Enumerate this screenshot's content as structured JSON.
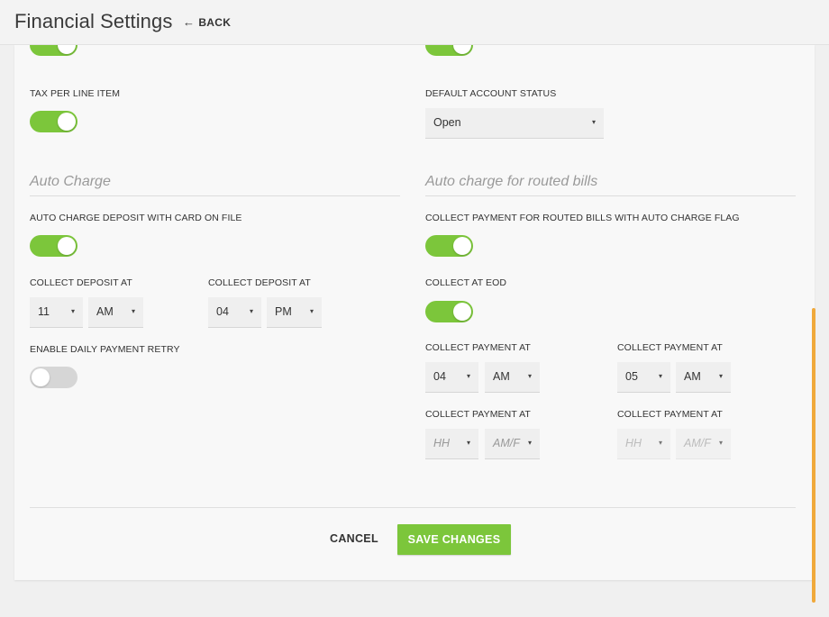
{
  "header": {
    "title": "Financial Settings",
    "back_label": "BACK",
    "back_arrow": "←"
  },
  "left_top": {
    "tax_per_line_item_label": "TAX PER LINE ITEM",
    "tax_per_line_item_enabled": true
  },
  "right_top": {
    "default_account_status_label": "DEFAULT ACCOUNT STATUS",
    "default_account_status_value": "Open"
  },
  "auto_charge": {
    "heading": "Auto Charge",
    "deposit_with_card_label": "AUTO CHARGE DEPOSIT WITH CARD ON FILE",
    "deposit_with_card_enabled": true,
    "collect_deposit_at_1": {
      "label": "COLLECT DEPOSIT AT",
      "hour": "11",
      "period": "AM"
    },
    "collect_deposit_at_2": {
      "label": "COLLECT DEPOSIT AT",
      "hour": "04",
      "period": "PM"
    },
    "daily_retry_label": "ENABLE DAILY PAYMENT RETRY",
    "daily_retry_enabled": false
  },
  "routed_bills": {
    "heading": "Auto charge for routed bills",
    "collect_payment_flag_label": "COLLECT PAYMENT FOR ROUTED BILLS WITH AUTO CHARGE FLAG",
    "collect_payment_flag_enabled": true,
    "collect_at_eod_label": "COLLECT AT EOD",
    "collect_at_eod_enabled": true,
    "payment_times": [
      {
        "label": "COLLECT PAYMENT AT",
        "hour": "04",
        "period": "AM"
      },
      {
        "label": "COLLECT PAYMENT AT",
        "hour": "05",
        "period": "AM"
      },
      {
        "label": "COLLECT PAYMENT AT",
        "hour": "HH",
        "period": "AM/F"
      },
      {
        "label": "COLLECT PAYMENT AT",
        "hour": "HH",
        "period": "AM/F"
      }
    ]
  },
  "footer": {
    "cancel_label": "CANCEL",
    "save_label": "SAVE CHANGES"
  },
  "icons": {
    "caret": "▾"
  },
  "colors": {
    "accent_green": "#7cc63b",
    "scrollbar": "#f0a93b",
    "toggle_off": "#d6d6d6"
  }
}
